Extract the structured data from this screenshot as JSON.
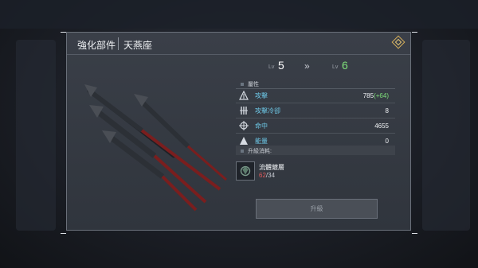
{
  "header": {
    "title": "強化部件",
    "subtitle": "天燕座",
    "info_icon": "diamond-info-icon"
  },
  "level": {
    "label": "Lv",
    "current": "5",
    "arrow": "»",
    "next": "6",
    "current_color": "#ffffff",
    "next_color": "#7ee07a"
  },
  "attributes": {
    "section_label": "屬性",
    "items": [
      {
        "icon": "attack-icon",
        "name": "攻擊",
        "value": "785",
        "bonus": "(+64)"
      },
      {
        "icon": "cooldown-icon",
        "name": "攻擊冷卻",
        "value": "8",
        "bonus": ""
      },
      {
        "icon": "crosshair-icon",
        "name": "命中",
        "value": "4655",
        "bonus": ""
      },
      {
        "icon": "energy-icon",
        "name": "能量",
        "value": "0",
        "bonus": ""
      }
    ]
  },
  "cost": {
    "section_label": "升級消耗:",
    "material_name": "流體鍍層",
    "have": "62",
    "need": "/34",
    "material_icon": "fluid-coating-icon"
  },
  "upgrade_button": {
    "label": "升級"
  },
  "colors": {
    "stat_name": "#6ec9e8",
    "bonus": "#7ee07a",
    "insufficient": "#e05a5a",
    "accent_gold": "#d9b15a"
  }
}
